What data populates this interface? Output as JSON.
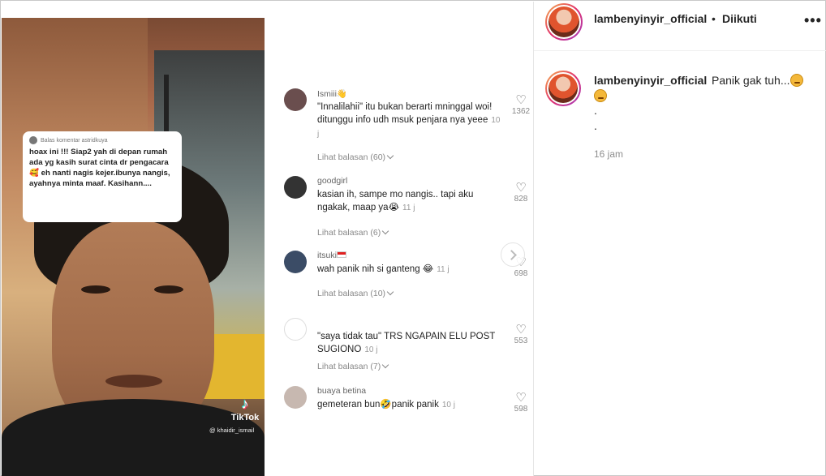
{
  "video": {
    "reply_header": "Balas komentar astridkuya",
    "reply_text": "hoax ini !!! Siap2 yah di depan rumah ada yg kasih surat cinta dr pengacara 🥰 eh nanti nagis kejer.ibunya nangis, ayahnya minta maaf. Kasihann....",
    "tiktok_name": "TikTok",
    "tiktok_handle": "@ khaidir_ismail"
  },
  "comments": [
    {
      "user": "Ismiii👋",
      "text": "\"Innalilahii\" itu bukan berarti mninggal woi! ditunggu info udh msuk penjara nya yeee",
      "time": "10 j",
      "replies": "Lihat balasan (60)",
      "likes": "1362"
    },
    {
      "user": "goodgirl",
      "text": "kasian ih, sampe mo nangis.. tapi aku ngakak, maap ya😭",
      "time": "11 j",
      "replies": "Lihat balasan (6)",
      "likes": "828"
    },
    {
      "user": "itsuki",
      "text": "wah panik nih si ganteng 😂",
      "time": "11 j",
      "replies": "Lihat balasan (10)",
      "likes": "698"
    },
    {
      "user": "",
      "text": "\"saya tidak tau\" TRS NGAPAIN ELU POST SUGIONO",
      "time": "10 j",
      "replies": "Lihat balasan (7)",
      "likes": "553"
    },
    {
      "user": "buaya betina",
      "text": "gemeteran bun🤣panik panik",
      "time": "10 j",
      "replies": "",
      "likes": "598"
    }
  ],
  "header": {
    "username": "lambenyinyir_official",
    "separator": "•",
    "follow_status": "Diikuti",
    "more": "•••"
  },
  "caption": {
    "username": "lambenyinyir_official",
    "text": "Panik gak tuh...",
    "dot1": ".",
    "dot2": ".",
    "time": "16 jam"
  },
  "colors": {
    "ring_start": "#f6b44c",
    "ring_end": "#a43ac0",
    "text": "#262626",
    "muted": "#8e8e8e"
  }
}
